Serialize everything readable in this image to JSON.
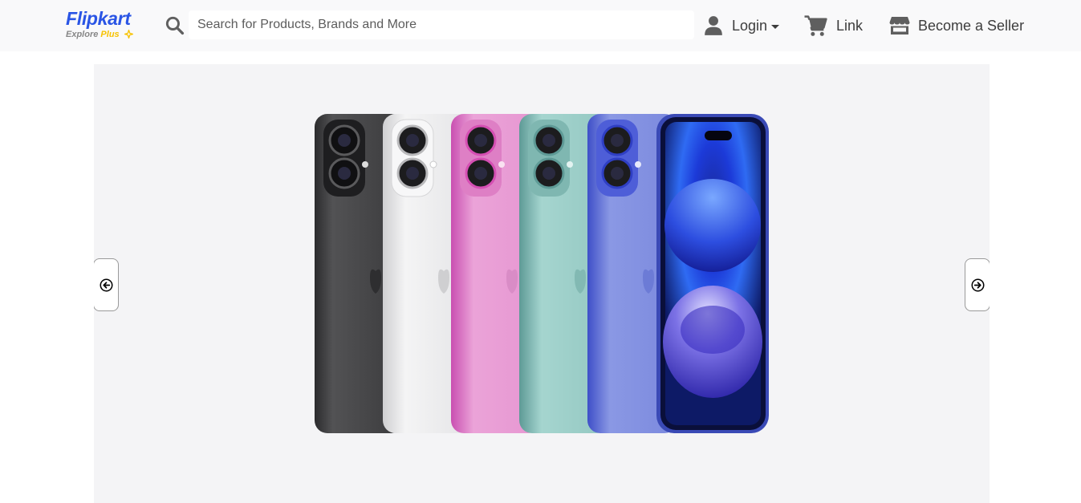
{
  "header": {
    "logo": {
      "brand": "Flipkart",
      "tagline": "Explore",
      "tagline_plus": "Plus"
    },
    "search": {
      "placeholder": "Search for Products, Brands and More",
      "icon": "search-icon"
    },
    "nav": {
      "login_label": "Login",
      "cart_label": "Link",
      "seller_label": "Become a Seller"
    }
  },
  "carousel": {
    "prev_icon": "arrow-left-circle-icon",
    "next_icon": "arrow-right-circle-icon",
    "slide": {
      "image": "phones-lineup"
    }
  },
  "colors": {
    "brand_blue": "#2a55e5",
    "brand_yellow": "#f7c200",
    "header_bg": "#f9f9fa",
    "carousel_bg": "#f4f4f6",
    "text": "#3d3d3d"
  }
}
